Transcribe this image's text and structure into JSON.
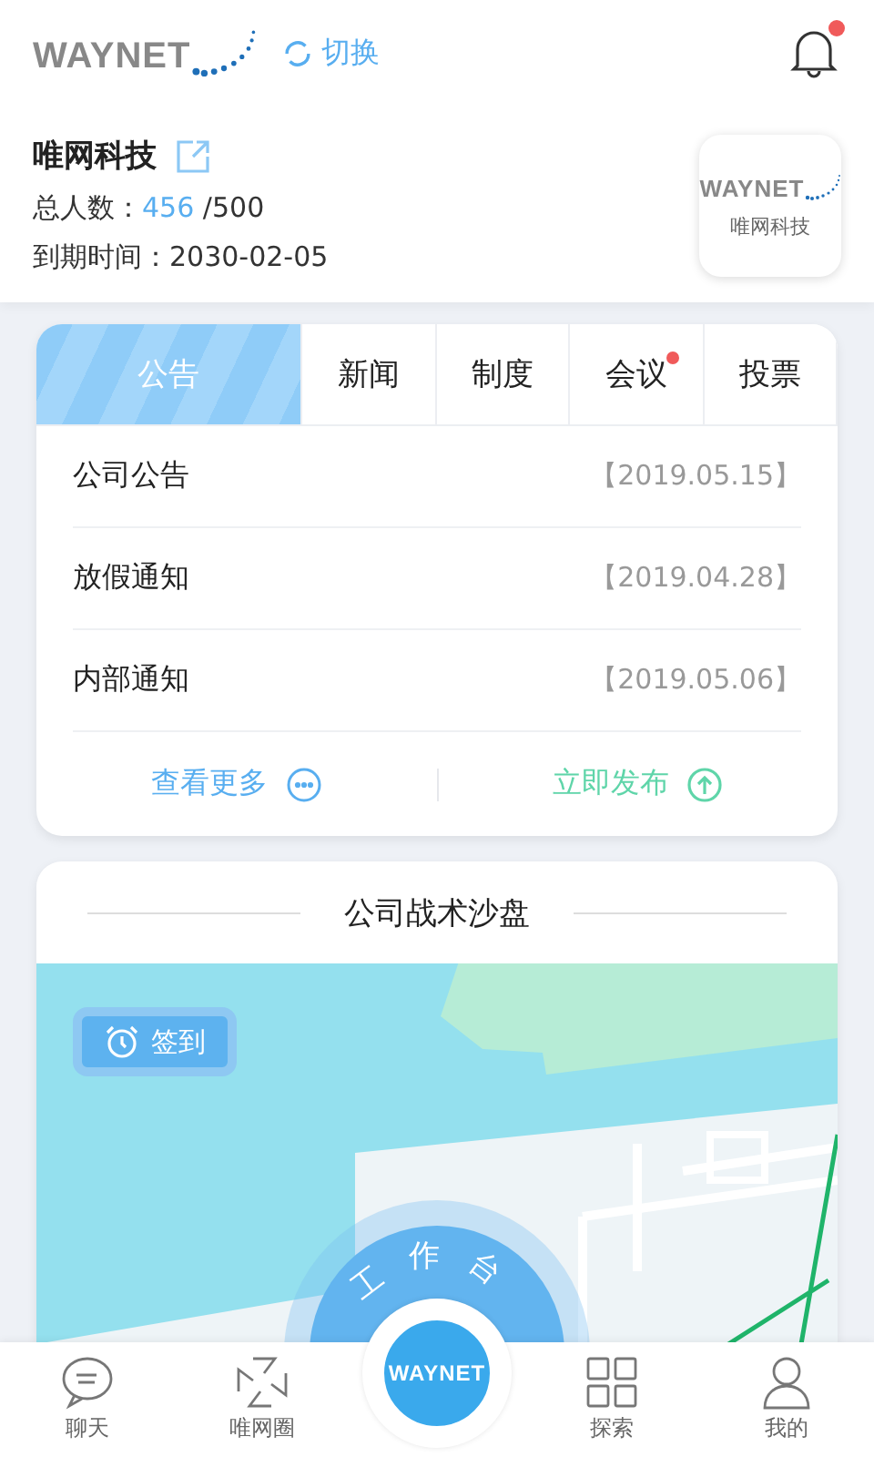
{
  "header": {
    "logo": "WAYNET",
    "switch_label": "切换",
    "has_notification": true
  },
  "company": {
    "name": "唯网科技",
    "members_label": "总人数：",
    "members_count": "456",
    "members_total": "/500",
    "expiry_label": "到期时间：",
    "expiry_date": "2030-02-05",
    "badge_logo": "WAYNET",
    "badge_name": "唯网科技"
  },
  "tabs": [
    {
      "label": "公告",
      "selected": true,
      "badge": false
    },
    {
      "label": "新闻",
      "selected": false,
      "badge": false
    },
    {
      "label": "制度",
      "selected": false,
      "badge": false
    },
    {
      "label": "会议",
      "selected": false,
      "badge": true
    },
    {
      "label": "投票",
      "selected": false,
      "badge": false
    }
  ],
  "notices": [
    {
      "title": "公司公告",
      "date": "【2019.05.15】"
    },
    {
      "title": "放假通知",
      "date": "【2019.04.28】"
    },
    {
      "title": "内部通知",
      "date": "【2019.05.06】"
    }
  ],
  "actions": {
    "more": "查看更多",
    "publish": "立即发布"
  },
  "sandbox": {
    "title": "公司战术沙盘",
    "checkin": "签到"
  },
  "workbench": {
    "label": "工作台",
    "logo": "WAYNET"
  },
  "nav": [
    {
      "label": "聊天",
      "kind": "chat"
    },
    {
      "label": "唯网圈",
      "kind": "circle"
    },
    {
      "kind": "center"
    },
    {
      "label": "探索",
      "kind": "explore"
    },
    {
      "label": "我的",
      "kind": "profile"
    }
  ]
}
